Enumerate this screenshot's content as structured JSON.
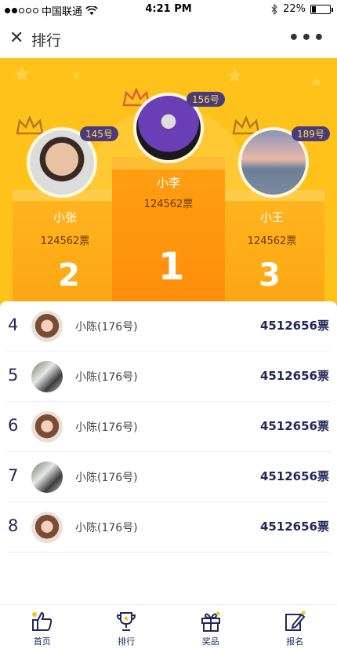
{
  "status_bar": {
    "carrier": "中国联通",
    "time": "4:21 PM",
    "battery": "22%",
    "battery_level": 0.22
  },
  "nav": {
    "title": "排行"
  },
  "podium": {
    "first": {
      "rank_label": "1",
      "badge": "156号",
      "name": "小李",
      "votes": "124562票"
    },
    "second": {
      "rank_label": "2",
      "badge": "145号",
      "name": "小张",
      "votes": "124562票"
    },
    "third": {
      "rank_label": "3",
      "badge": "189号",
      "name": "小王",
      "votes": "124562票"
    }
  },
  "list": [
    {
      "rank": "4",
      "name": "小陈(176号)",
      "votes": "4512656票"
    },
    {
      "rank": "5",
      "name": "小陈(176号)",
      "votes": "4512656票"
    },
    {
      "rank": "6",
      "name": "小陈(176号)",
      "votes": "4512656票"
    },
    {
      "rank": "7",
      "name": "小陈(176号)",
      "votes": "4512656票"
    },
    {
      "rank": "8",
      "name": "小陈(176号)",
      "votes": "4512656票"
    }
  ],
  "tabs": [
    {
      "label": "首页",
      "icon": "thumbs-up-icon"
    },
    {
      "label": "排行",
      "icon": "trophy-icon"
    },
    {
      "label": "奖品",
      "icon": "gift-icon"
    },
    {
      "label": "报名",
      "icon": "edit-icon"
    }
  ],
  "colors": {
    "hero_bg": "#ffc21a",
    "badge_bg": "#4a3b7a",
    "accent_text": "#23285a"
  }
}
